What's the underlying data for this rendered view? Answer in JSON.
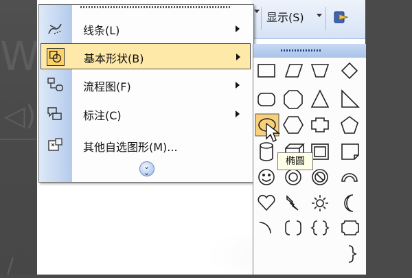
{
  "toolbar": {
    "display_label": "显示(S)",
    "extra_icon": "toolbar-options-icon"
  },
  "menu": {
    "items": [
      {
        "label": "线条(L)",
        "icon": "lines-icon",
        "has_submenu": true
      },
      {
        "label": "基本形状(B)",
        "icon": "basic-shapes-icon",
        "has_submenu": true,
        "active": true
      },
      {
        "label": "流程图(F)",
        "icon": "flowchart-icon",
        "has_submenu": true
      },
      {
        "label": "标注(C)",
        "icon": "callouts-icon",
        "has_submenu": true
      },
      {
        "label": "其他自选图形(M)...",
        "icon": "more-autoshapes-icon",
        "has_submenu": false
      }
    ],
    "expand_icon": "double-chevron-down-icon"
  },
  "shapes_panel": {
    "shapes": [
      "rectangle",
      "parallelogram",
      "trapezoid",
      "diamond",
      "rounded-rectangle",
      "octagon",
      "triangle",
      "right-triangle",
      "oval",
      "hexagon",
      "cross",
      "pentagon",
      "can",
      "cube",
      "bevel",
      "folded-corner",
      "smiley-face",
      "donut",
      "no-symbol",
      "block-arc",
      "heart",
      "lightning-bolt",
      "sun",
      "moon",
      "arc",
      "double-bracket",
      "double-brace",
      "plaque",
      "",
      "",
      "",
      "right-brace"
    ],
    "selected": "oval",
    "tooltip": "椭圆"
  },
  "colors": {
    "menu_highlight": "#ffe9a8",
    "icon_highlight": "#fbd267",
    "menu_strip": "#b5cbec",
    "tooltip_bg": "#ffffe7"
  }
}
